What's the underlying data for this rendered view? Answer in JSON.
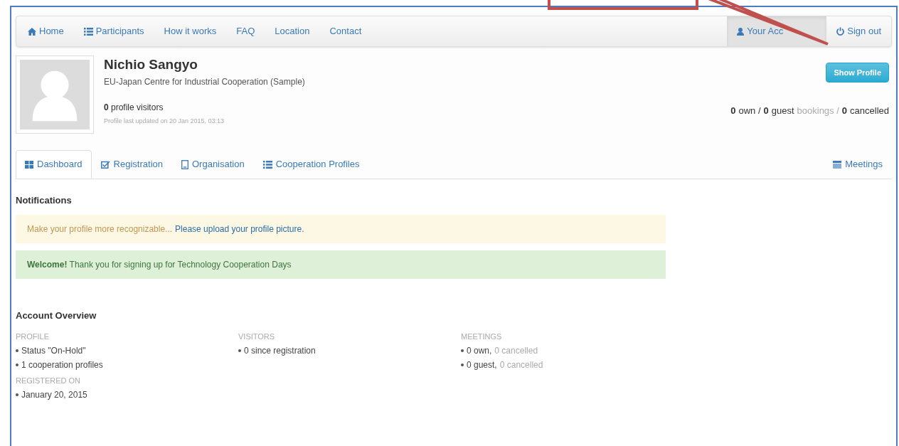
{
  "nav": {
    "left": [
      {
        "label": "Home"
      },
      {
        "label": "Participants"
      },
      {
        "label": "How it works"
      },
      {
        "label": "FAQ"
      },
      {
        "label": "Location"
      },
      {
        "label": "Contact"
      }
    ],
    "right": [
      {
        "label": "Your Acc",
        "selected": true
      },
      {
        "label": "Sign out",
        "selected": false
      }
    ]
  },
  "profile": {
    "name": "Nichio Sangyo",
    "organisation": "EU-Japan Centre for Industrial Cooperation (Sample)",
    "visitors": "**0** profile visitors",
    "updated": "Profile last updated on 20 Jan 2015, 03:13",
    "show_button": "Show Profile",
    "stats": [
      {
        "text": "0",
        "kind": "strong"
      },
      {
        "text": "own /",
        "kind": "plain"
      },
      {
        "text": "0",
        "kind": "strong"
      },
      {
        "text": "guest",
        "kind": "plain"
      },
      {
        "text": "bookings /",
        "kind": "muted"
      },
      {
        "text": "0",
        "kind": "strong"
      },
      {
        "text": "cancelled",
        "kind": "plain"
      }
    ]
  },
  "tabs": [
    {
      "label": "Dashboard",
      "selected": true
    },
    {
      "label": "Registration",
      "selected": false
    },
    {
      "label": "Organisation",
      "selected": false
    },
    {
      "label": "Cooperation Profiles",
      "selected": false
    }
  ],
  "side_tab": {
    "label": "Meetings",
    "selected": false
  },
  "notifications": {
    "title": "Notifications",
    "items": [
      {
        "kind": "warning",
        "text": "Make your profile more recognizable...",
        "link": "Please upload your profile picture."
      },
      {
        "kind": "success",
        "text": "**Welcome!** Thank you for signing up for Technology Cooperation Days"
      }
    ]
  },
  "overview": {
    "title": "Account Overview",
    "columns": [
      {
        "heading": "PROFILE",
        "items": [
          [
            {
              "text": "Status \"On-Hold\"",
              "muted": false
            }
          ],
          [
            {
              "text": "1 cooperation profiles",
              "muted": false
            }
          ]
        ],
        "sub_heading": "REGISTERED ON",
        "sub_items": [
          [
            {
              "text": "January 20, 2015",
              "muted": false
            }
          ]
        ]
      },
      {
        "heading": "VISITORS",
        "items": [
          [
            {
              "text": "0 since registration",
              "muted": false
            }
          ]
        ]
      },
      {
        "heading": "MEETINGS",
        "items": [
          [
            {
              "text": "0 own,",
              "muted": false
            },
            {
              "text": "0 cancelled",
              "muted": true
            }
          ],
          [
            {
              "text": "0 guest,",
              "muted": false
            },
            {
              "text": "0 cancelled",
              "muted": true
            }
          ]
        ]
      }
    ]
  }
}
